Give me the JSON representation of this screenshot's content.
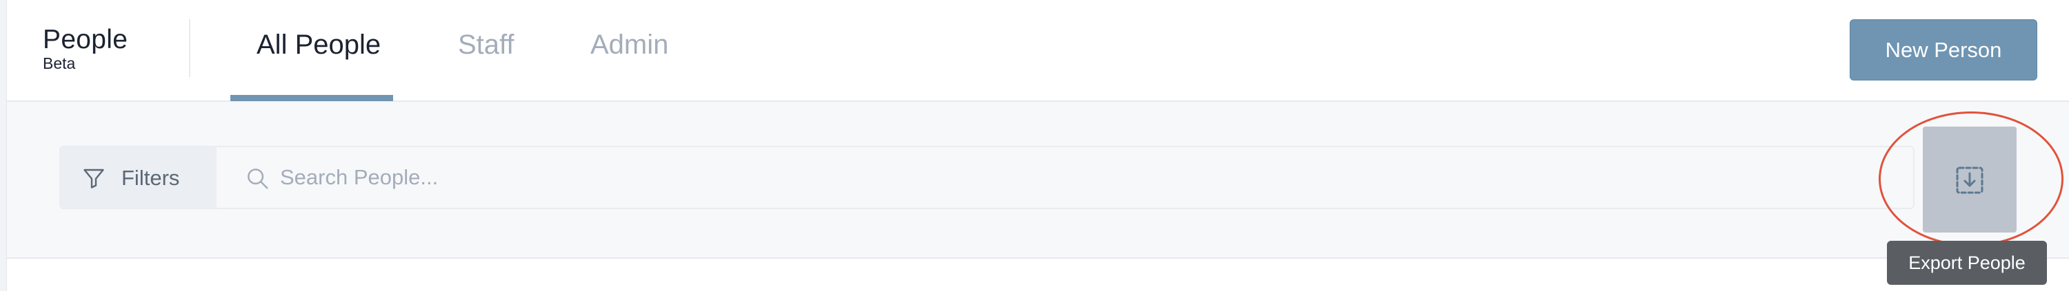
{
  "app": {
    "title": "People",
    "badge": "Beta"
  },
  "tabs": [
    {
      "label": "All People",
      "active": true
    },
    {
      "label": "Staff",
      "active": false
    },
    {
      "label": "Admin",
      "active": false
    }
  ],
  "header": {
    "new_button_label": "New Person"
  },
  "toolbar": {
    "filters_label": "Filters",
    "search_placeholder": "Search People...",
    "search_value": "",
    "export_tooltip": "Export People"
  },
  "colors": {
    "accent": "#6f95b2",
    "highlight": "#e1523b",
    "tooltip_bg": "#5a5e63"
  },
  "icons": {
    "filter": "funnel-icon",
    "search": "search-icon",
    "export": "download-icon"
  }
}
